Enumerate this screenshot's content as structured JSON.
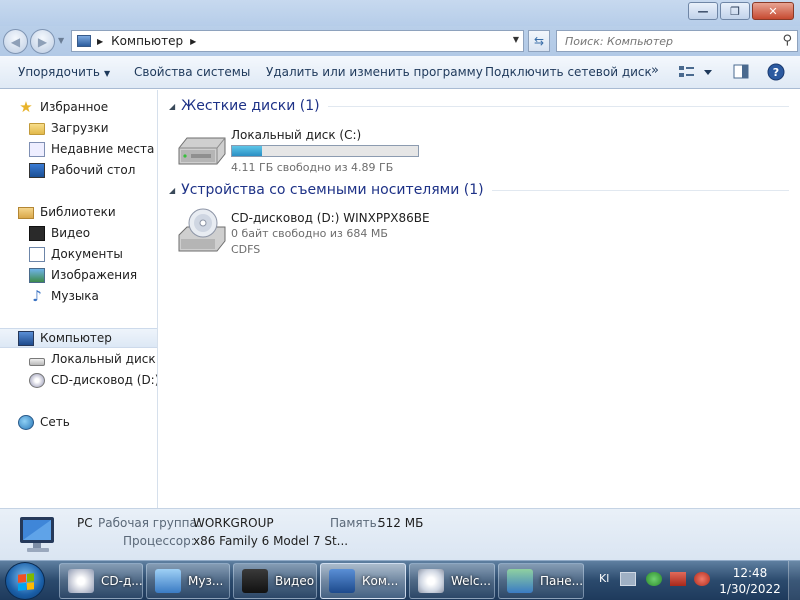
{
  "window": {
    "minimize_glyph": "—",
    "maximize_glyph": "❐",
    "close_glyph": "✕"
  },
  "address": {
    "back_glyph": "◀",
    "forward_glyph": "▶",
    "separator": "▶",
    "location": "Компьютер",
    "dropdown": "▼",
    "refresh_glyph": "⇆",
    "search_placeholder": "Поиск: Компьютер",
    "search_glyph": "⚲"
  },
  "toolbar": {
    "organize": "Упорядочить",
    "organize_arrow": "▼",
    "system_properties": "Свойства системы",
    "uninstall": "Удалить или изменить программу",
    "map_drive": "Подключить сетевой диск",
    "more": "»",
    "view_arrow": "▼",
    "help": "?"
  },
  "nav": {
    "favorites": "Избранное",
    "downloads": "Загрузки",
    "recent": "Недавние места",
    "desktop": "Рабочий стол",
    "libraries": "Библиотеки",
    "video": "Видео",
    "documents": "Документы",
    "pictures": "Изображения",
    "music": "Музыка",
    "computer": "Компьютер",
    "local_disk": "Локальный диск (C",
    "cd_drive": "CD-дисковод (D:) W",
    "network": "Сеть"
  },
  "content": {
    "group_triangle": "◢",
    "hdd_group": "Жесткие диски (1)",
    "removable_group": "Устройства со съемными носителями (1)",
    "c_drive": {
      "name": "Локальный диск (C:)",
      "free_text": "4.11 ГБ свободно из 4.89 ГБ",
      "used_fraction": 0.16
    },
    "d_drive": {
      "name": "CD-дисковод (D:) WINXPPX86BE",
      "free_text": "0 байт свободно из 684 МБ",
      "fs": "CDFS"
    }
  },
  "details": {
    "name": "PC",
    "workgroup_label": "Рабочая группа:",
    "workgroup": "WORKGROUP",
    "memory_label": "Память:",
    "memory": "512 МБ",
    "cpu_label": "Процессор:",
    "cpu": "x86 Family 6 Model 7 St..."
  },
  "taskbar": {
    "items": [
      {
        "label": "CD-д..."
      },
      {
        "label": "Муз..."
      },
      {
        "label": "Видео"
      },
      {
        "label": "Ком..."
      },
      {
        "label": "Welc..."
      },
      {
        "label": "Пане..."
      }
    ],
    "lang": "Kl",
    "time": "12:48",
    "date": "1/30/2022"
  },
  "colors": {
    "link_blue": "#1e3287",
    "usage_bar": "#2a8fc4",
    "taskbar": "#2b4a6d"
  }
}
